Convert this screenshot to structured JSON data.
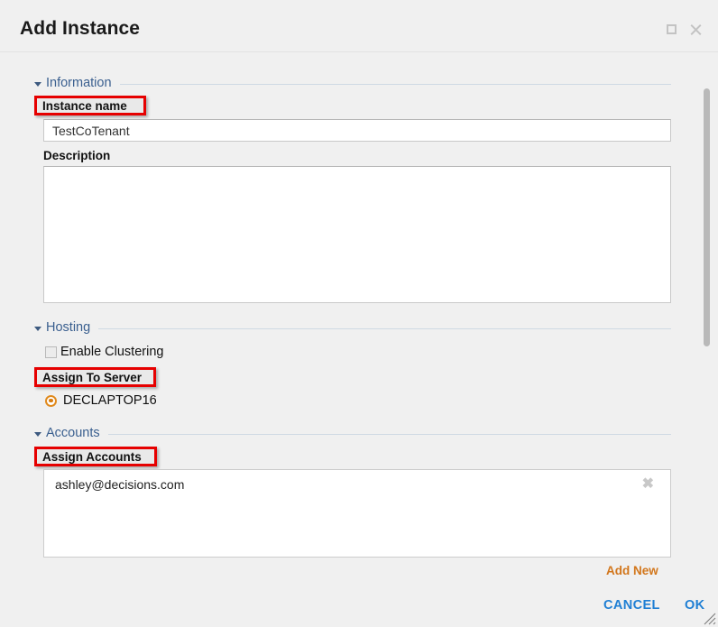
{
  "dialog": {
    "title": "Add Instance",
    "window_controls": [
      {
        "name": "maximize",
        "icon": "square-icon"
      },
      {
        "name": "close",
        "icon": "close-icon"
      }
    ]
  },
  "sections": {
    "information": {
      "title": "Information",
      "instance_name": {
        "label": "Instance name",
        "value": "TestCoTenant",
        "highlighted": true
      },
      "description": {
        "label": "Description",
        "value": "",
        "placeholder": ""
      }
    },
    "hosting": {
      "title": "Hosting",
      "enable_clustering": {
        "label": "Enable Clustering",
        "checked": false
      },
      "assign_to_server": {
        "label": "Assign To Server",
        "highlighted": true,
        "options": [
          {
            "label": "DECLAPTOP16",
            "selected": true
          }
        ]
      }
    },
    "accounts": {
      "title": "Accounts",
      "assign_accounts": {
        "label": "Assign Accounts",
        "highlighted": true,
        "items": [
          {
            "email": "ashley@decisions.com",
            "remove_glyph": "✖"
          }
        ],
        "add_new_label": "Add New"
      }
    }
  },
  "footer": {
    "cancel_label": "CANCEL",
    "ok_label": "OK"
  },
  "colors": {
    "accent_blue": "#1f7fd4",
    "section_blue": "#3a5f8f",
    "highlight_red": "#e60000",
    "orange": "#d2761b",
    "background": "#f0f0f0"
  }
}
